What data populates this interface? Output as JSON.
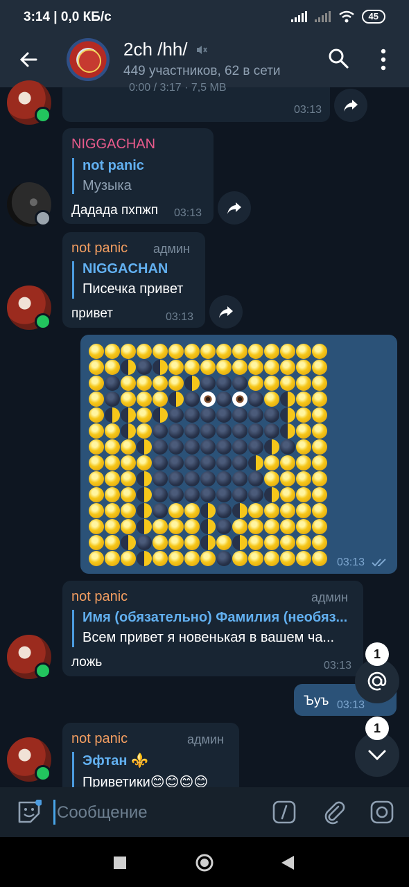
{
  "status": {
    "time": "3:14 | 0,0 КБ/с",
    "battery": "45"
  },
  "header": {
    "title": "2ch /hh/",
    "subtitle": "449 участников, 62 в сети",
    "avatar_text": "HIGH HEELS 2012"
  },
  "messages": {
    "partial_top": {
      "meta": "0:00 / 3:17 · 7,5 MB",
      "time": "03:13"
    },
    "m1": {
      "sender": "NIGGACHAN",
      "reply_name": "not panic",
      "reply_text": "Музыка",
      "text": "Дадада пхпжп",
      "time": "03:13"
    },
    "m2": {
      "sender": "not panic",
      "role": "админ",
      "reply_name": "NIGGACHAN",
      "reply_text": "Писечка привет",
      "text": "привет",
      "time": "03:13"
    },
    "moon_art": {
      "time": "03:13"
    },
    "m3": {
      "sender": "not panic",
      "role": "админ",
      "reply_name": "Имя (обязательно) Фамилия (необяз...",
      "reply_text": "Всем привет я новенькая в вашем ча...",
      "text": "ложь",
      "time": "03:13"
    },
    "out_short": {
      "text": "Ъуъ",
      "time": "03:13"
    },
    "m4": {
      "sender": "not panic",
      "role": "админ",
      "reply_name": "Эфтан ⚜️",
      "reply_text": "Приветики😊😊😊😊"
    }
  },
  "badges": {
    "mentions": "1",
    "unread": "1"
  },
  "input": {
    "placeholder": "Сообщение"
  },
  "colors": {
    "bg": "#0e1621",
    "bubble_in": "#182533",
    "bubble_out": "#2b5278",
    "accent": "#62b0f0",
    "online": "#22c55e"
  },
  "moon_grid": [
    "FFFFFFFFFFFFFFF",
    "FFHNHFFFFFFFFFF",
    "FNFFFFHNNNFFFFF",
    "FNFFFHNENENFHFF",
    "FHHFHNNNNNNNHFF",
    "FFHFNNNNNNNNHFF",
    "FFFHNNNNNNNHNFF",
    "FFFFNNNNNNHFFFF",
    "FFFHNNNNNNNFFFF",
    "FFFHNNNNNNNHFFF",
    "FFFHNFFHNHFFFFF",
    "FFFHFFFHNFFFFFF",
    "FFHNFFFHFHFFFFF",
    "FFFHFFFFNFFFFFF"
  ]
}
